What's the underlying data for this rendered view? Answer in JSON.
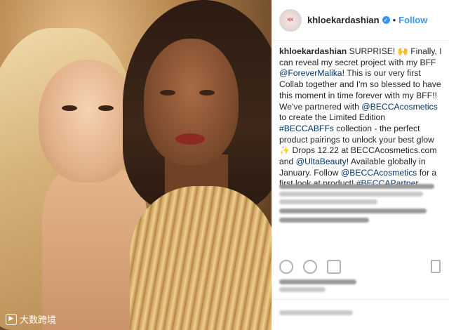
{
  "post": {
    "username": "khloekardashian",
    "follow_label": "Follow",
    "separator": "•",
    "caption": {
      "user": "khloekardashian",
      "segments": [
        {
          "text": " SURPRISE! 🙌  Finally, I can reveal my secret project with my BFF ",
          "type": "text"
        },
        {
          "text": "@ForeverMalika",
          "type": "mention"
        },
        {
          "text": "! This is our very first Collab together and I'm so blessed to have this moment in time forever with my BFF!! We've partnered with ",
          "type": "text"
        },
        {
          "text": "@BECCAcosmetics",
          "type": "mention"
        },
        {
          "text": " to create the Limited Edition ",
          "type": "text"
        },
        {
          "text": "#BECCABFFs",
          "type": "mention"
        },
        {
          "text": " collection - the perfect product pairings to unlock your best glow ✨  Drops 12.22 at BECCAcosmetics.com and ",
          "type": "text"
        },
        {
          "text": "@UltaBeauty",
          "type": "mention"
        },
        {
          "text": "! Available globally in January. Follow ",
          "type": "text"
        },
        {
          "text": "@BECCAcosmetics",
          "type": "mention"
        },
        {
          "text": " for a first look at product! ",
          "type": "text"
        },
        {
          "text": "#BECCAPartner",
          "type": "mention"
        }
      ]
    }
  },
  "watermark": {
    "text": "大数跨境"
  },
  "icons": {
    "verified": "verified-badge-icon",
    "like": "heart-icon",
    "comment": "comment-icon",
    "share": "share-icon",
    "save": "bookmark-icon"
  },
  "colors": {
    "link_blue": "#3897f0",
    "mention_blue": "#003569",
    "text": "#262626"
  }
}
